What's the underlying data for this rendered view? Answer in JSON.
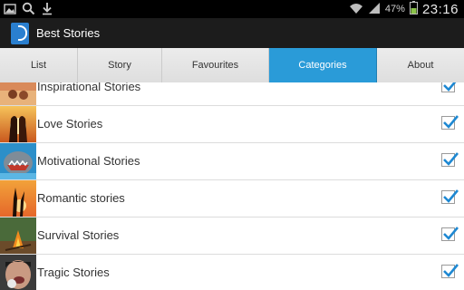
{
  "status_bar": {
    "battery_percent": "47%",
    "time": "23:16",
    "left_icons": [
      "gallery-icon",
      "search-icon",
      "download-icon"
    ],
    "right_icons": [
      "wifi-icon",
      "signal-icon",
      "battery-icon"
    ]
  },
  "action_bar": {
    "title": "Best Stories",
    "icon": "app-book-icon"
  },
  "tabs": [
    {
      "label": "List",
      "active": false
    },
    {
      "label": "Story",
      "active": false
    },
    {
      "label": "Favourites",
      "active": false
    },
    {
      "label": "Categories",
      "active": true
    },
    {
      "label": "About",
      "active": false
    }
  ],
  "categories": [
    {
      "label": "Inspirational Stories",
      "checked": true
    },
    {
      "label": "Love Stories",
      "checked": true
    },
    {
      "label": "Motivational Stories",
      "checked": true
    },
    {
      "label": "Romantic stories",
      "checked": true
    },
    {
      "label": "Survival Stories",
      "checked": true
    },
    {
      "label": "Tragic Stories",
      "checked": true
    }
  ],
  "colors": {
    "accent_tab": "#2a9bd8",
    "checkmark": "#1e88d2",
    "action_bar": "#1c1c1c"
  }
}
